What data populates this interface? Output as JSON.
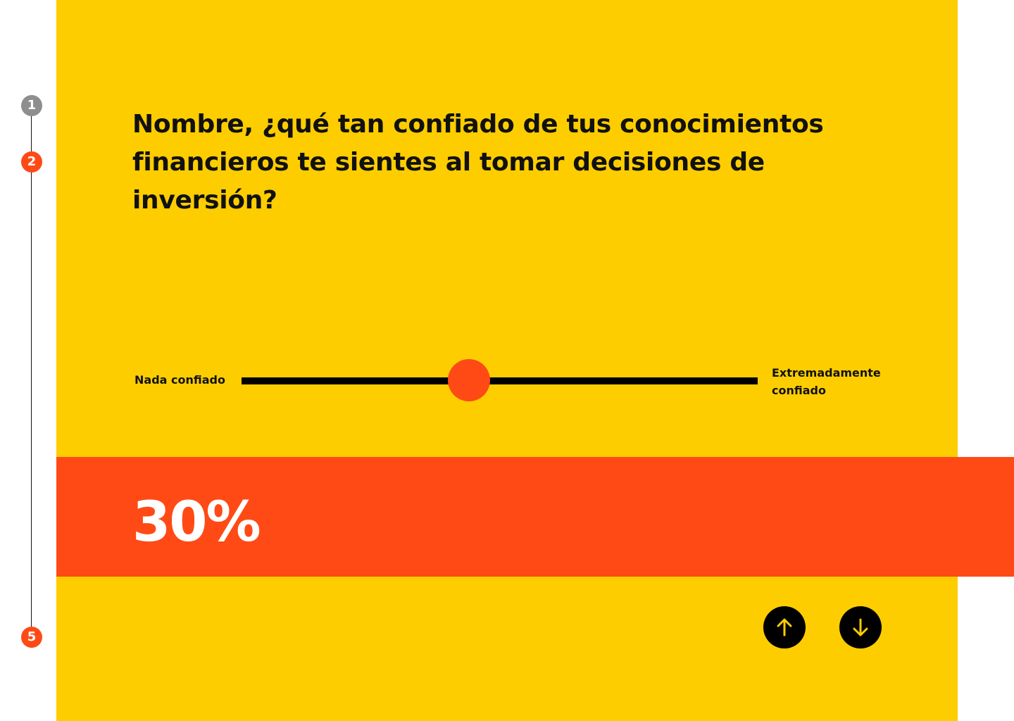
{
  "progress": {
    "steps": [
      {
        "number": "1",
        "state": "done"
      },
      {
        "number": "2",
        "state": "current"
      },
      {
        "number": "5",
        "state": "last"
      }
    ],
    "colors": {
      "done": "#8e8e8e",
      "active": "#ff4a15",
      "line": "#111111"
    }
  },
  "question": {
    "text": "Nombre, ¿qué tan confiado de tus conocimientos financieros te sientes al tomar decisiones de inversión?"
  },
  "slider": {
    "min_label": "Nada confiado",
    "max_label": "Extremadamente confiado",
    "value": 0.44,
    "thumb_color": "#ff4a15",
    "track_color": "#000000"
  },
  "result": {
    "value_text": "30%",
    "band_color": "#ff4a15"
  },
  "navigation": {
    "up_icon": "arrow-up-icon",
    "down_icon": "arrow-down-icon",
    "icon_color": "#fdcd00"
  },
  "theme": {
    "panel_color": "#fdcd00"
  }
}
